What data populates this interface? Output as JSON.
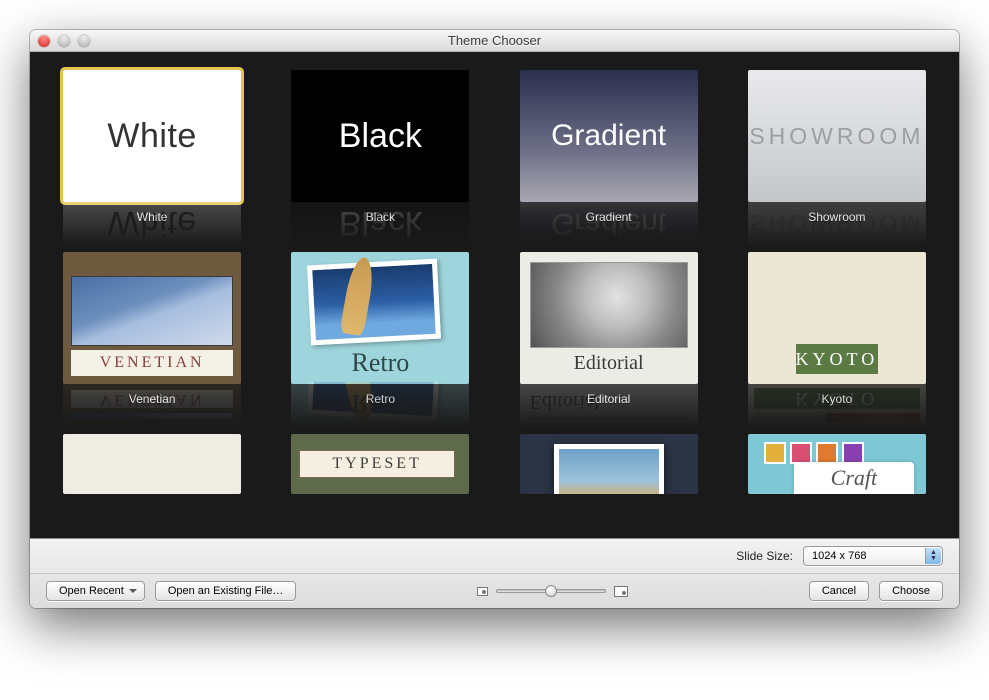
{
  "window": {
    "title": "Theme Chooser"
  },
  "themes": [
    {
      "label": "White",
      "display": "White"
    },
    {
      "label": "Black",
      "display": "Black"
    },
    {
      "label": "Gradient",
      "display": "Gradient"
    },
    {
      "label": "Showroom",
      "display": "SHOWROOM"
    },
    {
      "label": "Venetian",
      "display": "VENETIAN"
    },
    {
      "label": "Retro",
      "display": "Retro"
    },
    {
      "label": "Editorial",
      "display": "Editorial"
    },
    {
      "label": "Kyoto",
      "display": "KYOTO"
    },
    {
      "label": "",
      "display": ""
    },
    {
      "label": "",
      "display": "TYPESET"
    },
    {
      "label": "",
      "display": ""
    },
    {
      "label": "",
      "display": "Craft"
    }
  ],
  "footer": {
    "slide_size_label": "Slide Size:",
    "slide_size_value": "1024 x 768",
    "open_recent": "Open Recent",
    "open_existing": "Open an Existing File…",
    "cancel": "Cancel",
    "choose": "Choose"
  }
}
